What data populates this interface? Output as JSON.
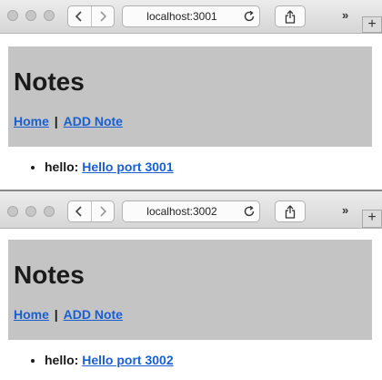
{
  "windows": [
    {
      "url": "localhost:3001",
      "page_title": "Notes",
      "nav": {
        "home": "Home",
        "separator": "|",
        "add_note": "ADD Note"
      },
      "items": [
        {
          "key": "hello:",
          "link": "Hello port 3001"
        }
      ]
    },
    {
      "url": "localhost:3002",
      "page_title": "Notes",
      "nav": {
        "home": "Home",
        "separator": "|",
        "add_note": "ADD Note"
      },
      "items": [
        {
          "key": "hello:",
          "link": "Hello port 3002"
        }
      ]
    }
  ],
  "toolbar": {
    "more_label": "»",
    "new_tab_label": "+"
  }
}
